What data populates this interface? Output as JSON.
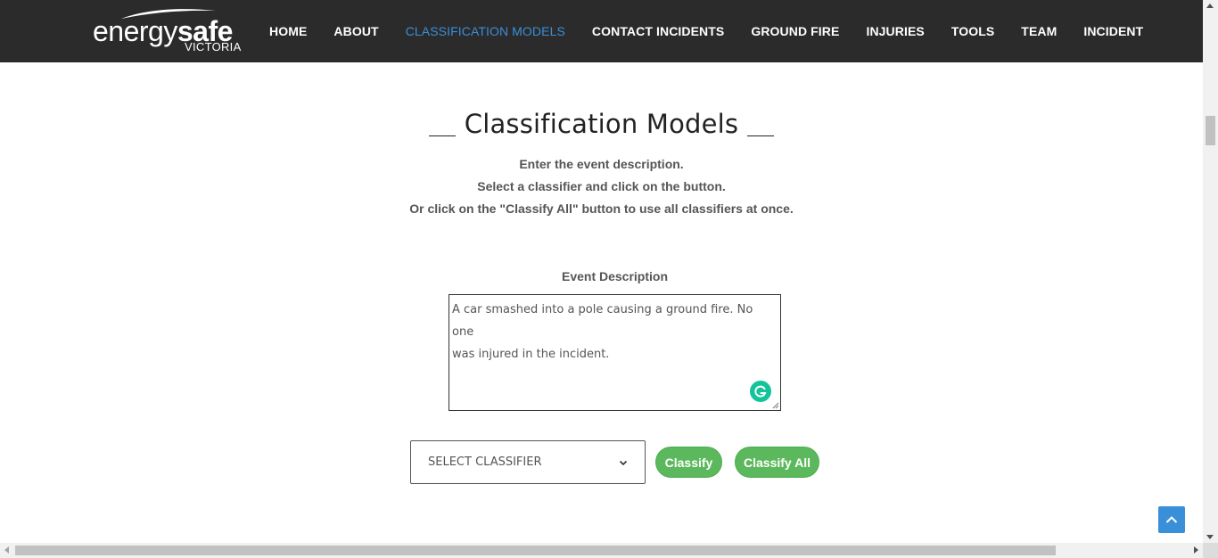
{
  "header": {
    "logo": {
      "brand_light": "energy",
      "brand_bold": "safe",
      "sub": "VICTORIA"
    },
    "nav": [
      {
        "label": "HOME",
        "active": false
      },
      {
        "label": "ABOUT",
        "active": false
      },
      {
        "label": "CLASSIFICATION MODELS",
        "active": true
      },
      {
        "label": "CONTACT INCIDENTS",
        "active": false
      },
      {
        "label": "GROUND FIRE",
        "active": false
      },
      {
        "label": "INJURIES",
        "active": false
      },
      {
        "label": "TOOLS",
        "active": false
      },
      {
        "label": "TEAM",
        "active": false
      },
      {
        "label": "INCIDENT",
        "active": false
      }
    ],
    "background_color": "#2b2b2b",
    "active_color": "#3a8fd9"
  },
  "main": {
    "title": "Classification Models",
    "instructions": [
      "Enter the event description.",
      "Select a classifier and click on the button.",
      "Or click on the \"Classify All\" button to use all classifiers at once."
    ],
    "event_description": {
      "label": "Event Description",
      "value_line1": "A car smashed into a pole causing a ground fire. No one",
      "value_line2": "was injured in the incident."
    },
    "classifier_select": {
      "selected": "SELECT CLASSIFIER"
    },
    "buttons": {
      "classify": "Classify",
      "classify_all": "Classify All",
      "color": "#5cb85c"
    }
  },
  "icons": {
    "back_to_top": "chevron-up-icon",
    "grammarly": "grammarly-icon",
    "select_chevron": "chevron-down-icon"
  }
}
